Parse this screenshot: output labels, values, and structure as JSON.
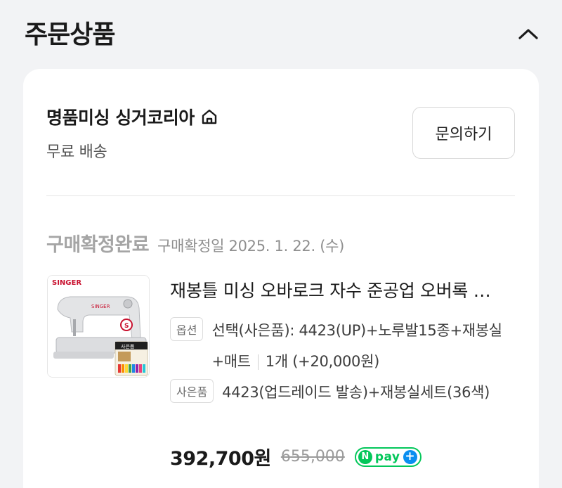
{
  "header": {
    "title": "주문상품"
  },
  "store": {
    "name": "명품미싱 싱거코리아",
    "shipping": "무료 배송",
    "inquiry_label": "문의하기"
  },
  "order": {
    "status": "구매확정완료",
    "status_date": "구매확정일 2025. 1. 22. (수)"
  },
  "product": {
    "brand_mark": "SINGER",
    "gift_badge": "사은품",
    "title": "재봉틀 미싱 오바로크 자수 준공업 오버록 …",
    "option_tag": "옵션",
    "option_text": "선택(사은품): 4423(UP)+노루발15종+재봉실+매트",
    "quantity": "1개 (+20,000원)",
    "gift_tag": "사은품",
    "gift_text": "4423(업드레이드 발송)+재봉실세트(36색)",
    "price": "392,700원",
    "original_price": "655,000",
    "npay_label": "pay"
  },
  "colors": {
    "npay_green": "#03c75a",
    "npay_blue": "#0a8ef0",
    "status_gray": "#a5a5a5"
  }
}
